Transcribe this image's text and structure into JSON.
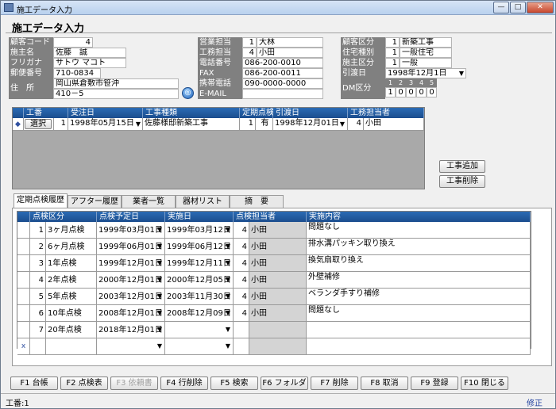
{
  "window": {
    "title": "施工データ入力"
  },
  "form_title": "施工データ入力",
  "customer": {
    "code_label": "顧客コード",
    "code": "4",
    "name_label": "施主名",
    "name": "佐藤　誠",
    "kana_label": "フリガナ",
    "kana": "サトウ マコト",
    "zip_label": "郵便番号",
    "zip": "710-0834",
    "address_label": "住　所",
    "address1": "岡山県倉敷市笹沖",
    "address2": "410－5"
  },
  "staff": {
    "sales_label": "営業担当",
    "sales_no": "1",
    "sales_name": "大林",
    "work_label": "工務担当",
    "work_no": "4",
    "work_name": "小田",
    "phone_label": "電話番号",
    "phone": "086-200-0010",
    "fax_label": "FAX",
    "fax": "086-200-0011",
    "mobile_label": "携帯電話",
    "mobile": "090-0000-0000",
    "email_label": "E-MAIL",
    "email": ""
  },
  "classification": {
    "cust_class_label": "顧客区分",
    "cust_class_no": "1",
    "cust_class": "新築工事",
    "house_type_label": "住宅種別",
    "house_type_no": "1",
    "house_type": "一般住宅",
    "owner_class_label": "施主区分",
    "owner_class_no": "1",
    "owner_class": "一般",
    "handover_label": "引渡日",
    "handover": "1998年12月1日",
    "dm_label": "DM区分",
    "dm_headers": [
      "1",
      "2",
      "3",
      "4",
      "5"
    ],
    "dm_values": [
      "1",
      "0",
      "0",
      "0",
      "0"
    ]
  },
  "work_grid": {
    "headers": [
      "工番",
      "受注日",
      "工事種類",
      "定期点検",
      "引渡日",
      "工務担当者"
    ],
    "row": {
      "select_label": "選択",
      "no": "1",
      "order_date": "1998年05月15日",
      "type": "佐藤様邸新築工事",
      "inspect_no": "1",
      "inspect": "有",
      "handover": "1998年12月01日",
      "staff_no": "4",
      "staff": "小田"
    }
  },
  "side_buttons": {
    "add": "工事追加",
    "delete": "工事削除"
  },
  "tabs": [
    "定期点検履歴",
    "アフター履歴",
    "業者一覧",
    "器材リスト",
    "摘　要"
  ],
  "inspect_grid": {
    "headers": [
      "点検区分",
      "点検予定日",
      "実施日",
      "点検担当者",
      "実施内容"
    ],
    "rows": [
      {
        "no": "1",
        "kind": "3ヶ月点検",
        "plan": "1999年03月01日",
        "done": "1999年03月12日",
        "staff_no": "4",
        "staff": "小田",
        "content": "問題なし"
      },
      {
        "no": "2",
        "kind": "6ヶ月点検",
        "plan": "1999年06月01日",
        "done": "1999年06月12日",
        "staff_no": "4",
        "staff": "小田",
        "content": "排水溝パッキン取り換え"
      },
      {
        "no": "3",
        "kind": "1年点検",
        "plan": "1999年12月01日",
        "done": "1999年12月11日",
        "staff_no": "4",
        "staff": "小田",
        "content": "換気扇取り換え"
      },
      {
        "no": "4",
        "kind": "2年点検",
        "plan": "2000年12月01日",
        "done": "2000年12月05日",
        "staff_no": "4",
        "staff": "小田",
        "content": "外壁補修"
      },
      {
        "no": "5",
        "kind": "5年点検",
        "plan": "2003年12月01日",
        "done": "2003年11月30日",
        "staff_no": "4",
        "staff": "小田",
        "content": "ベランダ手すり補修"
      },
      {
        "no": "6",
        "kind": "10年点検",
        "plan": "2008年12月01日",
        "done": "2008年12月09日",
        "staff_no": "4",
        "staff": "小田",
        "content": "問題なし"
      },
      {
        "no": "7",
        "kind": "20年点検",
        "plan": "2018年12月01日",
        "done": "",
        "staff_no": "",
        "staff": "",
        "content": ""
      }
    ],
    "new_row_marker": "x"
  },
  "fkeys": [
    "F1 台帳",
    "F2 点検表",
    "F3 依頼書",
    "F4 行削除",
    "F5 検索",
    "F6 フォルダ",
    "F7 削除",
    "F8 取消",
    "F9 登録",
    "F10 閉じる"
  ],
  "status": {
    "left": "工番:1",
    "right": "修正"
  }
}
